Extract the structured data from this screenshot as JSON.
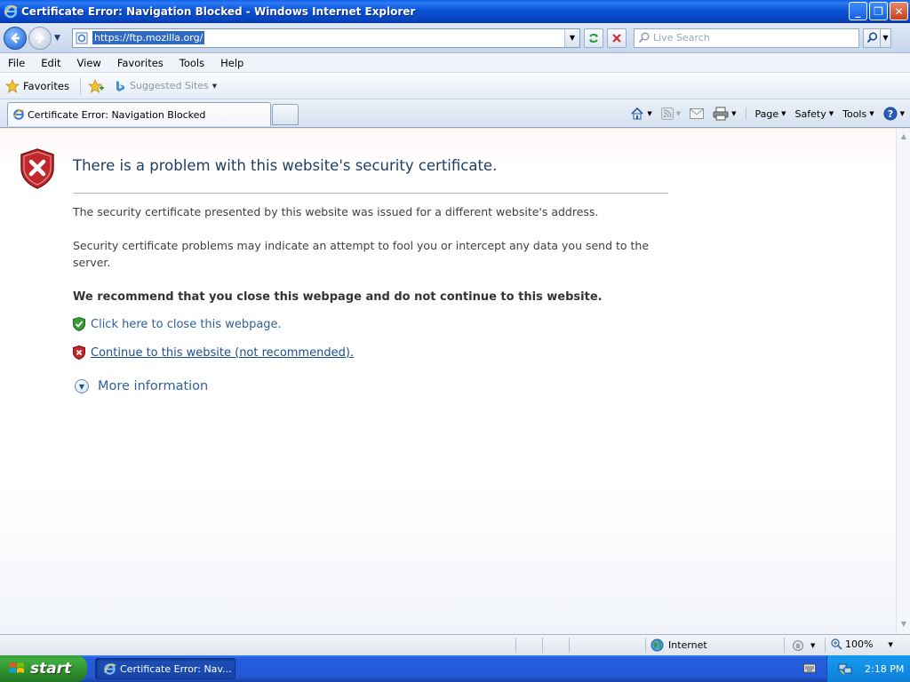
{
  "window": {
    "title": "Certificate Error: Navigation Blocked - Windows Internet Explorer",
    "controls": {
      "minimize": "_",
      "restore": "❐",
      "close": "✕"
    }
  },
  "address_bar": {
    "url": "https://ftp.mozilla.org/",
    "search_placeholder": "Live Search"
  },
  "menu": {
    "items": [
      "File",
      "Edit",
      "View",
      "Favorites",
      "Tools",
      "Help"
    ]
  },
  "favorites_bar": {
    "favorites_label": "Favorites",
    "suggested_sites_label": "Suggested Sites"
  },
  "tabs": {
    "active_tab_label": "Certificate Error: Navigation Blocked"
  },
  "command_bar": {
    "page_label": "Page",
    "safety_label": "Safety",
    "tools_label": "Tools"
  },
  "content": {
    "heading": "There is a problem with this website's security certificate.",
    "para1": "The security certificate presented by this website was issued for a different website's address.",
    "para2": "Security certificate problems may indicate an attempt to fool you or intercept any data you send to the server.",
    "recommend": "We recommend that you close this webpage and do not continue to this website.",
    "close_link": "Click here to close this webpage.",
    "continue_link": "Continue to this website (not recommended).",
    "more_info": "More information"
  },
  "status_bar": {
    "zone": "Internet",
    "zoom": "100%"
  },
  "taskbar": {
    "start_label": "start",
    "task_label": "Certificate Error: Nav...",
    "clock": "2:18 PM"
  },
  "colors": {
    "titlebar": "#0a55d8",
    "link": "#2e5f9e",
    "heading": "#1f3d66",
    "shield_red": "#c0282d",
    "shield_green": "#3a9a3a"
  }
}
